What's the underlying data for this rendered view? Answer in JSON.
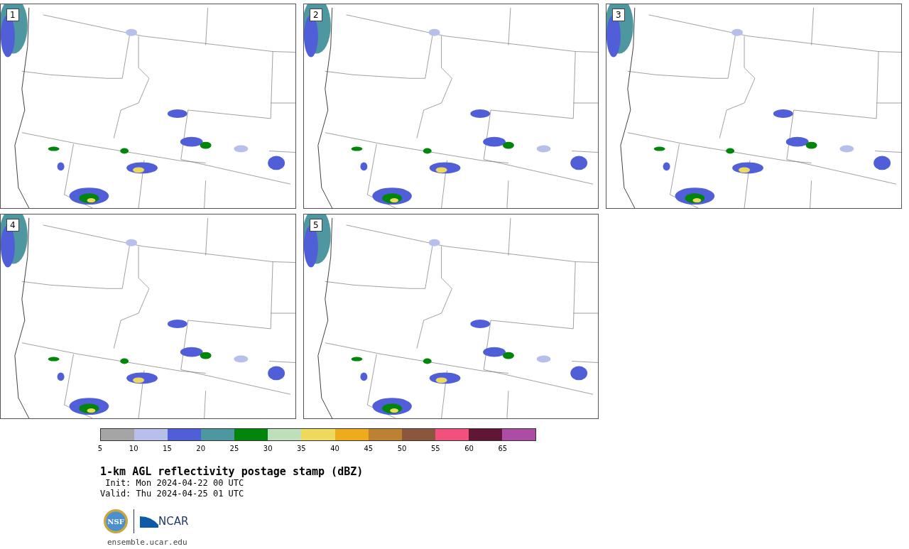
{
  "panels": [
    {
      "label": "1"
    },
    {
      "label": "2"
    },
    {
      "label": "3"
    },
    {
      "label": "4"
    },
    {
      "label": "5"
    }
  ],
  "colorbar": {
    "bins": [
      {
        "color": "#a5a5a5"
      },
      {
        "color": "#b7c0eb"
      },
      {
        "color": "#505fd8"
      },
      {
        "color": "#4f97a0"
      },
      {
        "color": "#01850a"
      },
      {
        "color": "#bfdfbb"
      },
      {
        "color": "#eed95d"
      },
      {
        "color": "#eeab1b"
      },
      {
        "color": "#bc8232"
      },
      {
        "color": "#8a573d"
      },
      {
        "color": "#f2507d"
      },
      {
        "color": "#601735"
      },
      {
        "color": "#ac4ca4"
      }
    ],
    "ticks": [
      "5",
      "10",
      "15",
      "20",
      "25",
      "30",
      "35",
      "40",
      "45",
      "50",
      "55",
      "60",
      "65"
    ]
  },
  "title": "1-km AGL reflectivity postage stamp (dBZ)",
  "init": " Init: Mon 2024-04-22 00 UTC",
  "valid": "Valid: Thu 2024-04-25 01 UTC",
  "logos": {
    "nsf": "NSF",
    "ncar": "NCAR"
  },
  "footer": "ensemble.ucar.edu"
}
